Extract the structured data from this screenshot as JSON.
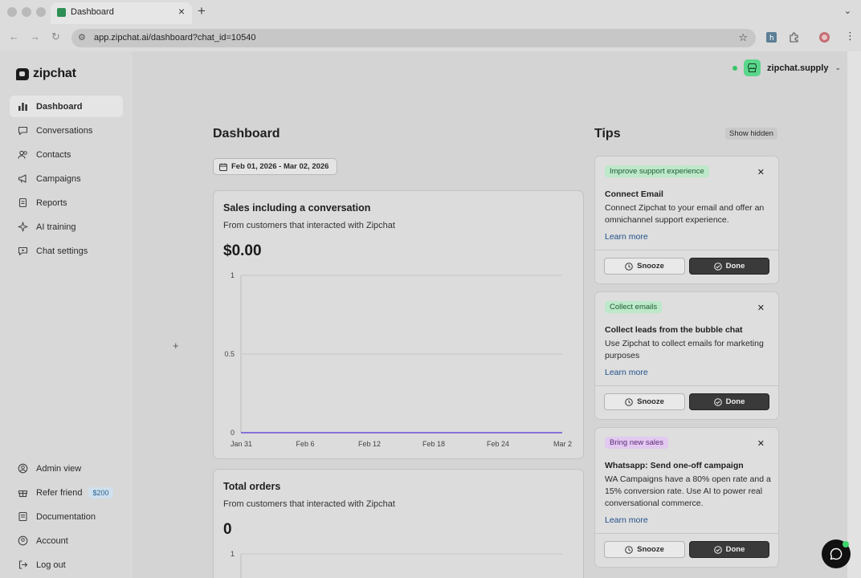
{
  "browser": {
    "tab_title": "Dashboard",
    "url": "app.zipchat.ai/dashboard?chat_id=10540"
  },
  "sidebar": {
    "logo": "zipchat",
    "items": [
      {
        "label": "Dashboard",
        "icon": "bar-chart-icon",
        "active": true
      },
      {
        "label": "Conversations",
        "icon": "chat-icon"
      },
      {
        "label": "Contacts",
        "icon": "users-icon"
      },
      {
        "label": "Campaigns",
        "icon": "megaphone-icon"
      },
      {
        "label": "Reports",
        "icon": "document-icon"
      },
      {
        "label": "AI training",
        "icon": "sparkle-icon"
      },
      {
        "label": "Chat settings",
        "icon": "chat-settings-icon"
      }
    ],
    "bottom_items": [
      {
        "label": "Admin view",
        "icon": "user-circle-icon"
      },
      {
        "label": "Refer friend",
        "icon": "gift-icon",
        "badge": "$200"
      },
      {
        "label": "Documentation",
        "icon": "book-icon"
      },
      {
        "label": "Account",
        "icon": "account-icon"
      },
      {
        "label": "Log out",
        "icon": "logout-icon"
      }
    ]
  },
  "header": {
    "account_name": "zipchat.supply",
    "status_color": "#3bc46b"
  },
  "main": {
    "title": "Dashboard",
    "date_range": "Feb 01, 2026 - Mar 02, 2026",
    "cards": [
      {
        "title": "Sales including a conversation",
        "subtitle": "From customers that interacted with Zipchat",
        "value": "$0.00"
      },
      {
        "title": "Total orders",
        "subtitle": "From customers that interacted with Zipchat",
        "value": "0"
      }
    ]
  },
  "chart_data": [
    {
      "type": "line",
      "title": "",
      "x": [
        "Jan 31",
        "Feb 6",
        "Feb 12",
        "Feb 18",
        "Feb 24",
        "Mar 2"
      ],
      "series": [
        {
          "values": [
            0,
            0,
            0,
            0,
            0,
            0
          ],
          "color": "#6c4fd8"
        }
      ],
      "yticks": [
        "1",
        "0.5",
        "0"
      ],
      "ylim": [
        0,
        1
      ],
      "grid": true
    },
    {
      "type": "line",
      "title": "",
      "yticks": [
        "1"
      ],
      "grid": true
    }
  ],
  "tips": {
    "title": "Tips",
    "show_hidden": "Show hidden",
    "snooze_label": "Snooze",
    "done_label": "Done",
    "learn_more": "Learn more",
    "items": [
      {
        "tag": "Improve support experience",
        "tag_color": "#bde8c9",
        "title": "Connect Email",
        "body": "Connect Zipchat to your email and offer an omnichannel support experience."
      },
      {
        "tag": "Collect emails",
        "tag_color": "#bde8c9",
        "title": "Collect leads from the bubble chat",
        "body": "Use Zipchat to collect emails for marketing purposes"
      },
      {
        "tag": "Bring new sales",
        "tag_color": "#e3c9f0",
        "title": "Whatsapp: Send one-off campaign",
        "body": "WA Campaigns have a 80% open rate and a 15% conversion rate. Use AI to power real conversational commerce."
      }
    ]
  }
}
